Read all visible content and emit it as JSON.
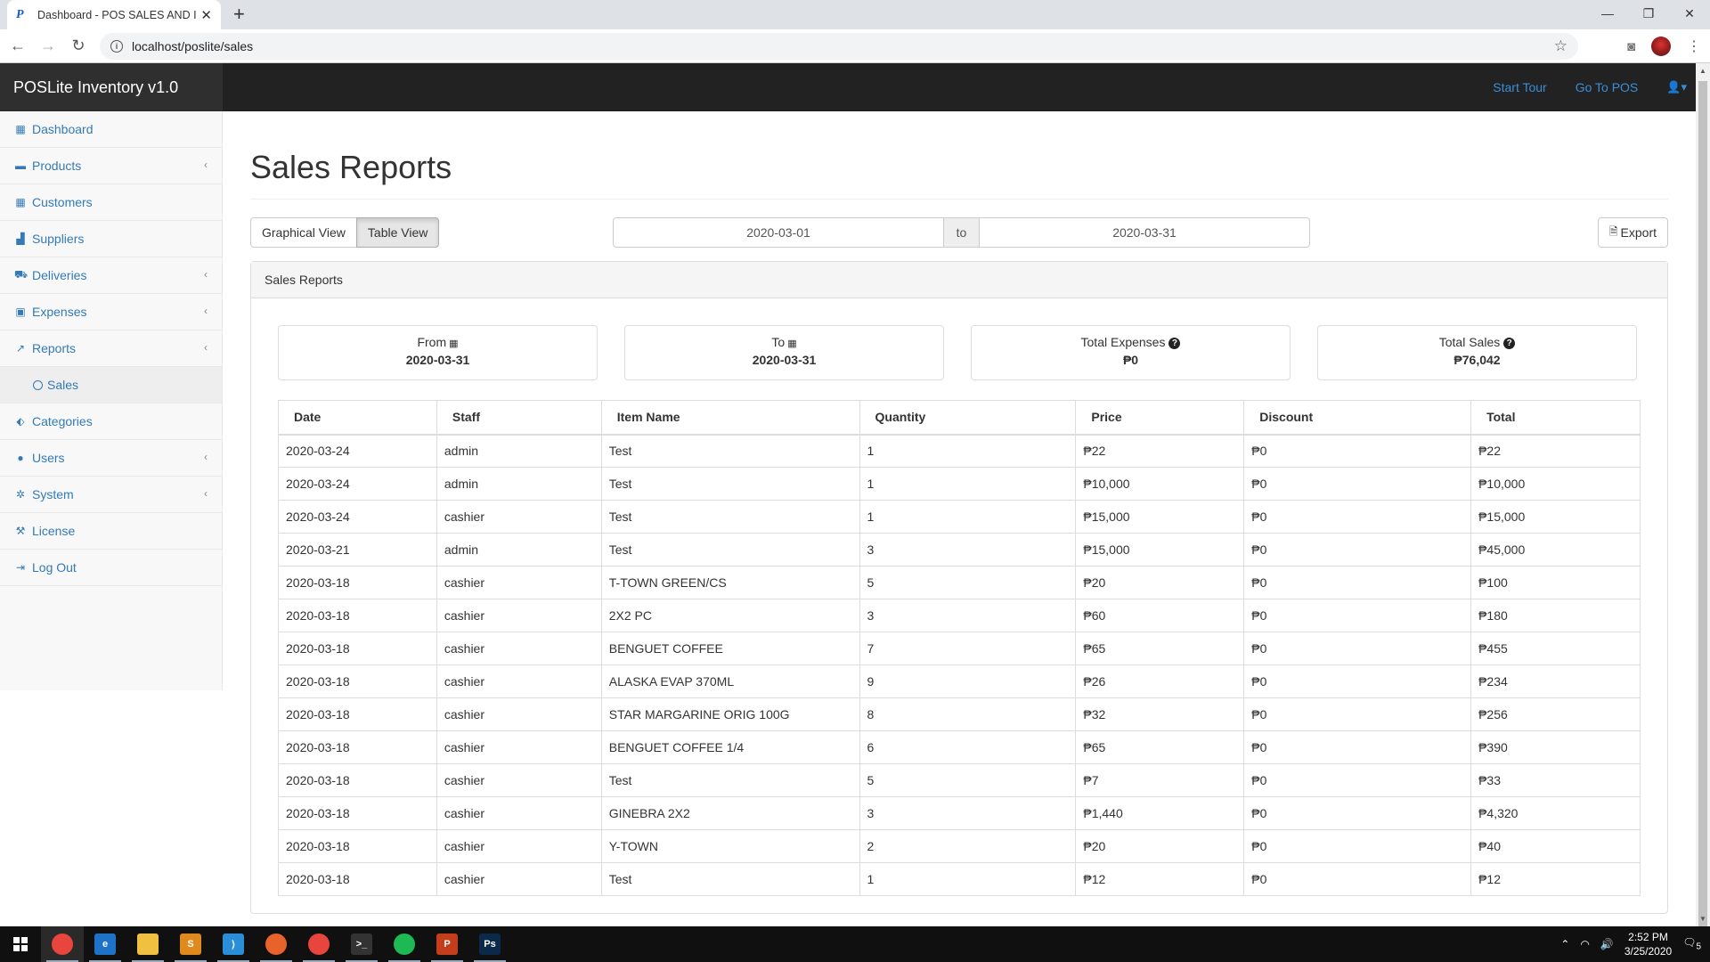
{
  "browser": {
    "tab_title": "Dashboard - POS SALES AND INVENTORY",
    "tab_favicon": "P",
    "url": "localhost/poslite/sales"
  },
  "app": {
    "brand": "POSLite Inventory v1.0",
    "header_links": {
      "start_tour": "Start Tour",
      "go_to_pos": "Go To POS"
    }
  },
  "sidebar": {
    "items": [
      {
        "label": "Dashboard",
        "icon": "table-icon",
        "glyph": "▦",
        "has_arrow": false
      },
      {
        "label": "Products",
        "icon": "folder-icon",
        "glyph": "▬",
        "has_arrow": true
      },
      {
        "label": "Customers",
        "icon": "table-icon",
        "glyph": "▦",
        "has_arrow": false
      },
      {
        "label": "Suppliers",
        "icon": "bar-chart-icon",
        "glyph": "▟",
        "has_arrow": false
      },
      {
        "label": "Deliveries",
        "icon": "truck-icon",
        "glyph": "⛟",
        "has_arrow": true
      },
      {
        "label": "Expenses",
        "icon": "money-icon",
        "glyph": "▣",
        "has_arrow": true
      },
      {
        "label": "Reports",
        "icon": "line-chart-icon",
        "glyph": "↗",
        "has_arrow": true
      },
      {
        "label": "Categories",
        "icon": "tags-icon",
        "glyph": "⬖",
        "has_arrow": false
      },
      {
        "label": "Users",
        "icon": "users-icon",
        "glyph": "●",
        "has_arrow": true
      },
      {
        "label": "System",
        "icon": "gear-icon",
        "glyph": "✲",
        "has_arrow": true
      },
      {
        "label": "License",
        "icon": "wrench-icon",
        "glyph": "⚒",
        "has_arrow": false
      },
      {
        "label": "Log Out",
        "icon": "sign-out-icon",
        "glyph": "⇥",
        "has_arrow": false
      }
    ],
    "sub_item": "Sales"
  },
  "main": {
    "title": "Sales Reports",
    "view_buttons": {
      "graphical": "Graphical View",
      "table": "Table View"
    },
    "date_from": "2020-03-01",
    "date_to": "2020-03-31",
    "date_separator": "to",
    "export_label": "Export",
    "panel_title": "Sales Reports",
    "stats": [
      {
        "label": "From",
        "value": "2020-03-31",
        "icon": "calendar-icon"
      },
      {
        "label": "To",
        "value": "2020-03-31",
        "icon": "calendar-icon"
      },
      {
        "label": "Total Expenses",
        "value": "₱0",
        "icon": "question-circle-icon"
      },
      {
        "label": "Total Sales",
        "value": "₱76,042",
        "icon": "question-circle-icon"
      }
    ],
    "table": {
      "columns": [
        "Date",
        "Staff",
        "Item Name",
        "Quantity",
        "Price",
        "Discount",
        "Total"
      ],
      "rows": [
        [
          "2020-03-24",
          "admin",
          "Test",
          "1",
          "₱22",
          "₱0",
          "₱22"
        ],
        [
          "2020-03-24",
          "admin",
          "Test",
          "1",
          "₱10,000",
          "₱0",
          "₱10,000"
        ],
        [
          "2020-03-24",
          "cashier",
          "Test",
          "1",
          "₱15,000",
          "₱0",
          "₱15,000"
        ],
        [
          "2020-03-21",
          "admin",
          "Test",
          "3",
          "₱15,000",
          "₱0",
          "₱45,000"
        ],
        [
          "2020-03-18",
          "cashier",
          "T-TOWN GREEN/CS",
          "5",
          "₱20",
          "₱0",
          "₱100"
        ],
        [
          "2020-03-18",
          "cashier",
          "2X2 PC",
          "3",
          "₱60",
          "₱0",
          "₱180"
        ],
        [
          "2020-03-18",
          "cashier",
          "BENGUET COFFEE",
          "7",
          "₱65",
          "₱0",
          "₱455"
        ],
        [
          "2020-03-18",
          "cashier",
          "ALASKA EVAP 370ML",
          "9",
          "₱26",
          "₱0",
          "₱234"
        ],
        [
          "2020-03-18",
          "cashier",
          "STAR MARGARINE ORIG 100G",
          "8",
          "₱32",
          "₱0",
          "₱256"
        ],
        [
          "2020-03-18",
          "cashier",
          "BENGUET COFFEE 1/4",
          "6",
          "₱65",
          "₱0",
          "₱390"
        ],
        [
          "2020-03-18",
          "cashier",
          "Test",
          "5",
          "₱7",
          "₱0",
          "₱33"
        ],
        [
          "2020-03-18",
          "cashier",
          "GINEBRA 2X2",
          "3",
          "₱1,440",
          "₱0",
          "₱4,320"
        ],
        [
          "2020-03-18",
          "cashier",
          "Y-TOWN",
          "2",
          "₱20",
          "₱0",
          "₱40"
        ],
        [
          "2020-03-18",
          "cashier",
          "Test",
          "1",
          "₱12",
          "₱0",
          "₱12"
        ]
      ]
    }
  },
  "taskbar": {
    "time": "2:52 PM",
    "date": "3/25/2020",
    "notification_count": "5",
    "apps": [
      {
        "name": "chrome-icon",
        "label": "",
        "color": "#e8453c",
        "active": true
      },
      {
        "name": "edge-icon",
        "label": "e",
        "color": "#1e73c8",
        "active": false
      },
      {
        "name": "file-explorer-icon",
        "label": "",
        "color": "#f0c040",
        "active": false
      },
      {
        "name": "sublime-text-icon",
        "label": "S",
        "color": "#e08a1e",
        "active": false
      },
      {
        "name": "vscode-icon",
        "label": "⟩",
        "color": "#2a8fd8",
        "active": false
      },
      {
        "name": "firefox-icon",
        "label": "",
        "color": "#e8632b",
        "active": false
      },
      {
        "name": "chrome-icon",
        "label": "",
        "color": "#e8453c",
        "active": false
      },
      {
        "name": "terminal-icon",
        "label": ">_",
        "color": "#333",
        "active": false
      },
      {
        "name": "spotify-icon",
        "label": "",
        "color": "#1db954",
        "active": false
      },
      {
        "name": "powerpoint-icon",
        "label": "P",
        "color": "#c43e1c",
        "active": false
      },
      {
        "name": "photoshop-icon",
        "label": "Ps",
        "color": "#0b2a4a",
        "active": false
      }
    ]
  },
  "colors": {
    "accent": "#337ab7",
    "header_bg": "#222222",
    "link": "#3a8fd9"
  }
}
